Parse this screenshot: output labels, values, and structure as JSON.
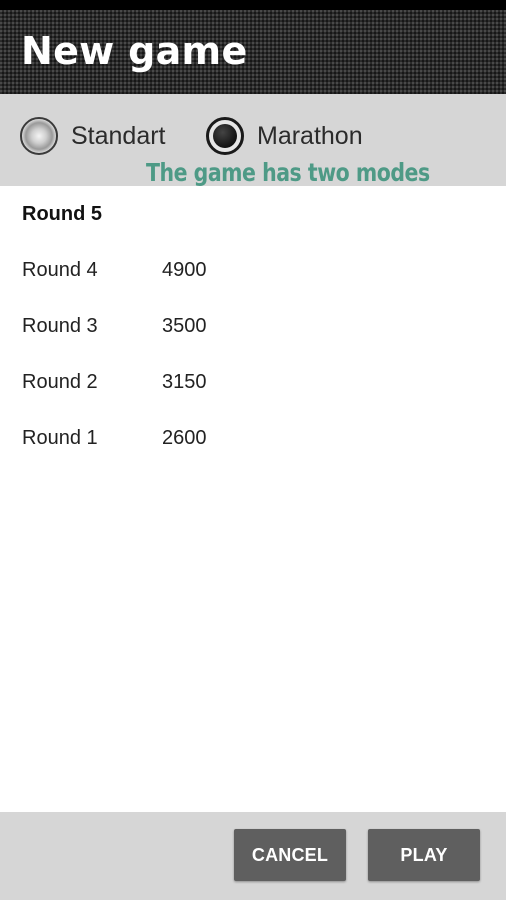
{
  "header": {
    "title": "New game"
  },
  "modes": {
    "options": [
      {
        "label": "Standart",
        "selected": false
      },
      {
        "label": "Marathon",
        "selected": true
      }
    ]
  },
  "caption": "The game has two modes",
  "rounds": [
    {
      "label": "Round 5",
      "score": "",
      "current": true
    },
    {
      "label": "Round 4",
      "score": "4900",
      "current": false
    },
    {
      "label": "Round 3",
      "score": "3500",
      "current": false
    },
    {
      "label": "Round 2",
      "score": "3150",
      "current": false
    },
    {
      "label": "Round 1",
      "score": "2600",
      "current": false
    }
  ],
  "footer": {
    "cancel_label": "CANCEL",
    "play_label": "PLAY"
  },
  "colors": {
    "caption": "#4e9a86",
    "button": "#5f5f5f",
    "mode_bar": "#d6d6d6"
  }
}
